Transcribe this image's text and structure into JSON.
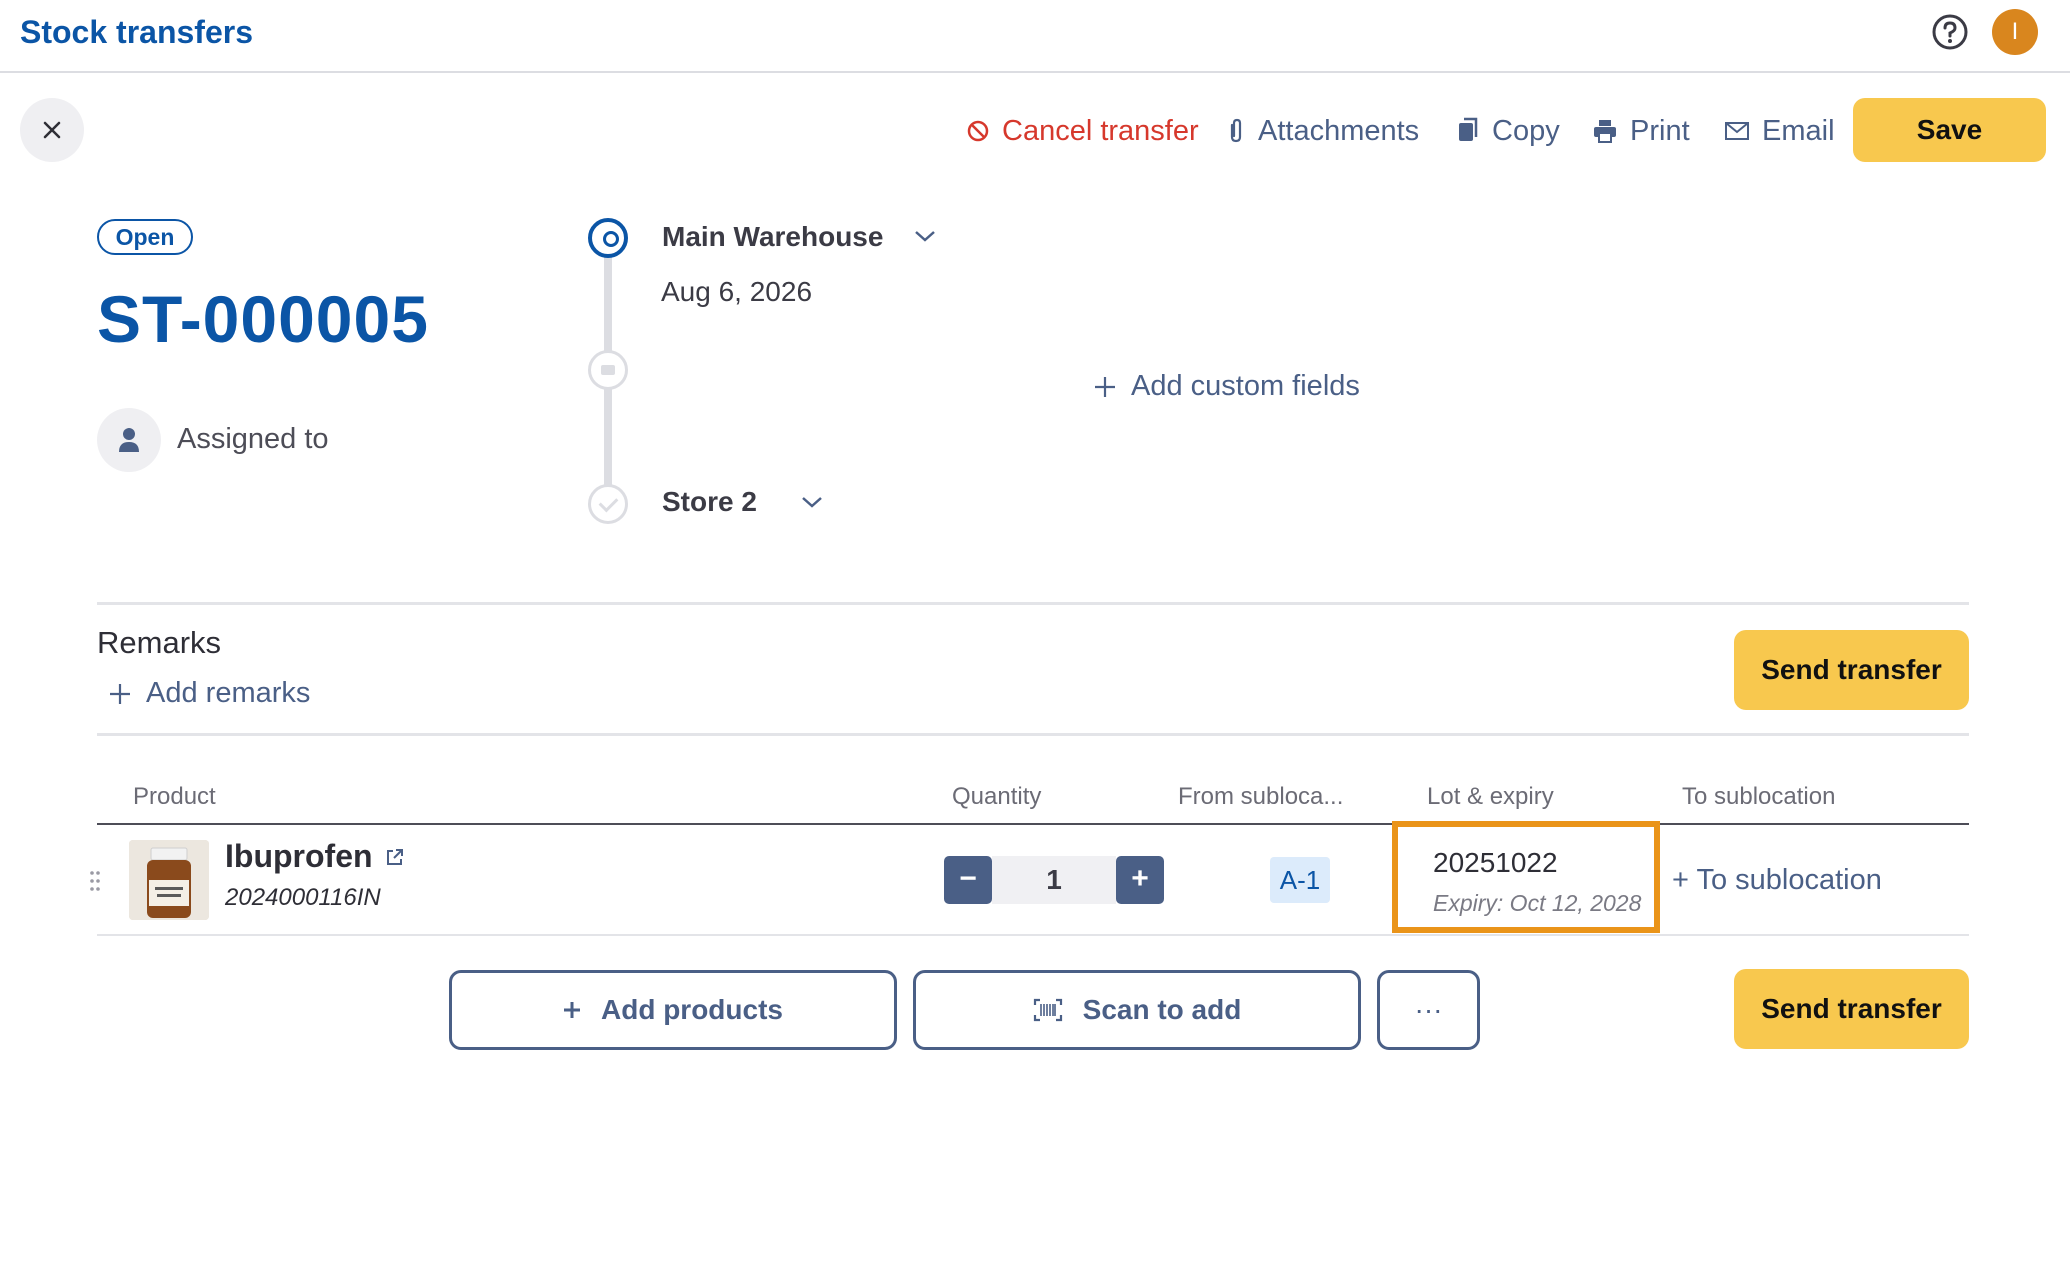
{
  "header": {
    "title": "Stock transfers",
    "help_icon": "help-circle-icon",
    "avatar_initial": "I",
    "avatar_color": "#d9861e"
  },
  "toolbar": {
    "cancel_label": "Cancel transfer",
    "attachments_label": "Attachments",
    "copy_label": "Copy",
    "print_label": "Print",
    "email_label": "Email",
    "save_label": "Save"
  },
  "transfer": {
    "status": "Open",
    "number": "ST-000005",
    "assigned_label": "Assigned to",
    "from_location": "Main Warehouse",
    "date": "Aug 6, 2026",
    "to_location": "Store 2",
    "add_custom_fields_label": "Add custom fields"
  },
  "remarks": {
    "title": "Remarks",
    "add_label": "Add remarks"
  },
  "actions": {
    "send_transfer_label": "Send transfer",
    "add_products_label": "Add products",
    "scan_label": "Scan to add",
    "more_label": "···"
  },
  "table": {
    "columns": [
      "Product",
      "Quantity",
      "From subloca...",
      "Lot & expiry",
      "To sublocation"
    ],
    "rows": [
      {
        "product_name": "Ibuprofen",
        "sku": "2024000116IN",
        "quantity": "1",
        "from_sublocation": "A-1",
        "lot_number": "20251022",
        "expiry": "Expiry: Oct 12, 2028",
        "to_sublocation_label": "+ To sublocation"
      }
    ]
  },
  "colors": {
    "brand_blue": "#0b55a6",
    "accent_yellow": "#f8c84e",
    "danger": "#d6382c",
    "highlight": "#ea9419"
  }
}
